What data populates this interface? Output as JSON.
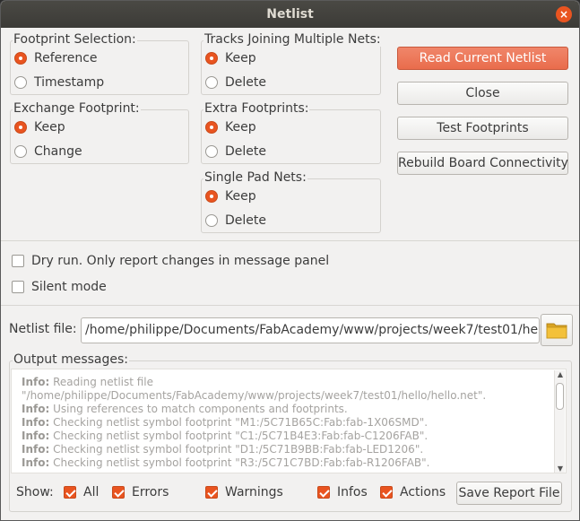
{
  "window": {
    "title": "Netlist",
    "close_glyph": "×"
  },
  "footprint_selection": {
    "label": "Footprint Selection:",
    "options": [
      "Reference",
      "Timestamp"
    ],
    "selected": "Reference"
  },
  "exchange_footprint": {
    "label": "Exchange Footprint:",
    "options": [
      "Keep",
      "Change"
    ],
    "selected": "Keep"
  },
  "tracks_joining": {
    "label": "Tracks Joining Multiple Nets:",
    "options": [
      "Keep",
      "Delete"
    ],
    "selected": "Keep"
  },
  "extra_footprints": {
    "label": "Extra Footprints:",
    "options": [
      "Keep",
      "Delete"
    ],
    "selected": "Keep"
  },
  "single_pad_nets": {
    "label": "Single Pad Nets:",
    "options": [
      "Keep",
      "Delete"
    ],
    "selected": "Keep"
  },
  "buttons": {
    "read_netlist": "Read Current Netlist",
    "close": "Close",
    "test_footprints": "Test Footprints",
    "rebuild": "Rebuild Board Connectivity",
    "save_report": "Save Report File"
  },
  "options": {
    "dry_run": {
      "label": "Dry run. Only report changes in message panel",
      "checked": false
    },
    "silent_mode": {
      "label": "Silent mode",
      "checked": false
    }
  },
  "netlist_file": {
    "label": "Netlist file:",
    "value": "/home/philippe/Documents/FabAcademy/www/projects/week7/test01/hel",
    "icon": "folder-icon"
  },
  "output": {
    "label": "Output messages:",
    "messages": [
      {
        "tag": "Info:",
        "text": " Reading netlist file"
      },
      {
        "tag": "",
        "text": "\"/home/philippe/Documents/FabAcademy/www/projects/week7/test01/hello/hello.net\"."
      },
      {
        "tag": "Info:",
        "text": " Using references to match components and footprints."
      },
      {
        "tag": "Info:",
        "text": " Checking netlist symbol footprint \"M1:/5C71B65C:Fab:fab-1X06SMD\"."
      },
      {
        "tag": "Info:",
        "text": " Checking netlist symbol footprint \"C1:/5C71B4E3:Fab:fab-C1206FAB\"."
      },
      {
        "tag": "Info:",
        "text": " Checking netlist symbol footprint \"D1:/5C71B9BB:Fab:fab-LED1206\"."
      },
      {
        "tag": "Info:",
        "text": " Checking netlist symbol footprint \"R3:/5C71C7BD:Fab:fab-R1206FAB\"."
      }
    ]
  },
  "filters": {
    "show_label": "Show:",
    "all": "All",
    "errors": "Errors",
    "warnings": "Warnings",
    "infos": "Infos",
    "actions": "Actions",
    "checked": {
      "all": true,
      "errors": true,
      "warnings": true,
      "infos": true,
      "actions": true
    }
  },
  "colors": {
    "accent": "#e95420",
    "titlebar": "#3c3b37",
    "window_bg": "#f2f1f0"
  }
}
